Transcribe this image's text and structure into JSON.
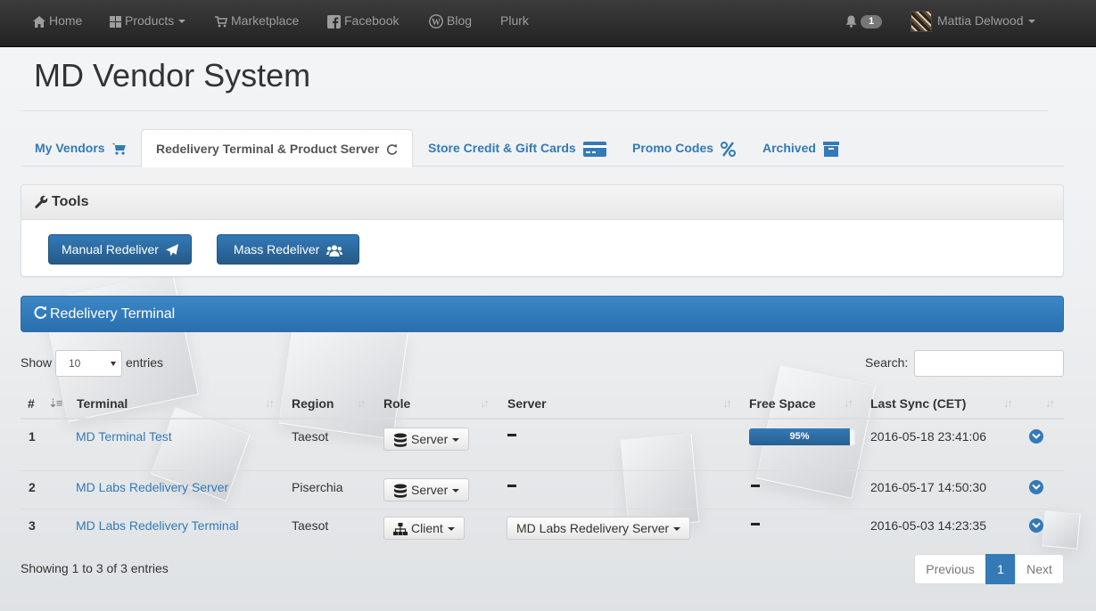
{
  "navbar": {
    "items": [
      {
        "label": "Home",
        "icon": "home-icon"
      },
      {
        "label": "Products",
        "icon": "grid-icon"
      },
      {
        "label": "Marketplace",
        "icon": "cart-icon"
      },
      {
        "label": "Facebook",
        "icon": "facebook-icon"
      },
      {
        "label": "Blog",
        "icon": "wordpress-icon"
      },
      {
        "label": "Plurk"
      }
    ],
    "notifications_count": "1",
    "user_name": "Mattia Delwood"
  },
  "page": {
    "title": "MD Vendor System"
  },
  "tabs": [
    {
      "label": "My Vendors",
      "icon": "cart-icon"
    },
    {
      "label": "Redelivery Terminal & Product Server",
      "icon": "refresh-icon",
      "active": true
    },
    {
      "label": "Store Credit & Gift Cards",
      "icon": "credit-card-icon"
    },
    {
      "label": "Promo Codes",
      "icon": "percent-icon"
    },
    {
      "label": "Archived",
      "icon": "archive-icon"
    }
  ],
  "tools_panel": {
    "title": "Tools",
    "manual_redeliver": "Manual Redeliver",
    "mass_redeliver": "Mass Redeliver"
  },
  "terminal_panel": {
    "title": "Redelivery Terminal"
  },
  "table_controls": {
    "show_label": "Show",
    "entries_label": "entries",
    "page_size": "10",
    "search_label": "Search:",
    "search_value": ""
  },
  "table": {
    "columns": [
      "#",
      "Terminal",
      "Region",
      "Role",
      "Server",
      "Free Space",
      "Last Sync (CET)"
    ],
    "rows": [
      {
        "num": "1",
        "terminal": "MD Terminal Test",
        "region": "Taesot",
        "role": "Server",
        "server": "",
        "free_space": "95%",
        "free_space_value": 95,
        "last_sync": "2016-05-18 23:41:06"
      },
      {
        "num": "2",
        "terminal": "MD Labs Redelivery Server",
        "region": "Piserchia",
        "role": "Server",
        "server": "",
        "free_space": "",
        "last_sync": "2016-05-17 14:50:30"
      },
      {
        "num": "3",
        "terminal": "MD Labs Redelivery Terminal",
        "region": "Taesot",
        "role": "Client",
        "server": "MD Labs Redelivery Server",
        "free_space": "",
        "last_sync": "2016-05-03 14:23:35"
      }
    ]
  },
  "footer": {
    "info": "Showing 1 to 3 of 3 entries",
    "previous": "Previous",
    "current_page": "1",
    "next": "Next"
  },
  "colors": {
    "primary": "#337ab7",
    "navbar": "#222222",
    "link": "#337ab7"
  }
}
